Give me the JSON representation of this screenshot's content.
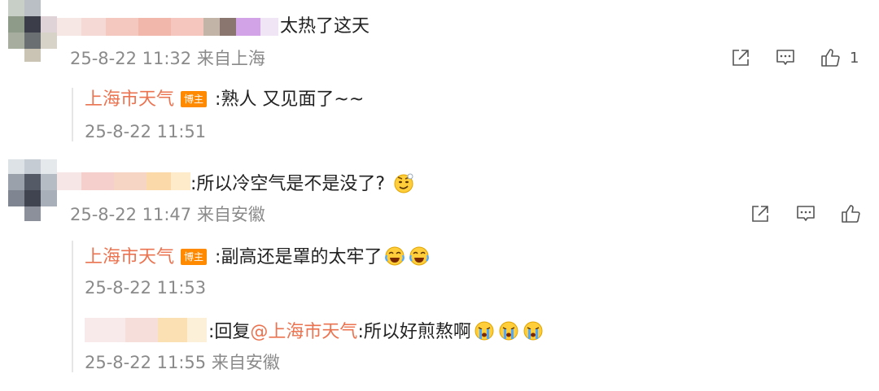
{
  "comments": [
    {
      "text": "太热了这天",
      "meta": "25-8-22 11:32 来自上海",
      "like_count": "1",
      "replies": [
        {
          "name": "上海市天气",
          "badge": "博主",
          "text": ":熟人 又见面了~~",
          "meta": "25-8-22 11:51"
        }
      ]
    },
    {
      "text": ":所以冷空气是不是没了?",
      "meta": "25-8-22 11:47 来自安徽",
      "replies": [
        {
          "name": "上海市天气",
          "badge": "博主",
          "text": ":副高还是罩的太牢了",
          "meta": "25-8-22 11:53"
        },
        {
          "reply_prefix": ":回复",
          "mention": "@上海市天气",
          "text": ":所以好煎熬啊",
          "meta": "25-8-22 11:55 来自安徽"
        }
      ]
    }
  ],
  "icons": {
    "share": "share-icon",
    "comment": "comment-icon",
    "like": "thumbs-up-icon",
    "emoji_smirk": "smirk-emoji-icon",
    "emoji_laugh_cry": "laugh-cry-emoji-icon",
    "emoji_cry": "cry-emoji-icon"
  },
  "colors": {
    "blogger_name": "#eb7350",
    "badge_bg": "#ff8a00",
    "meta_text": "#8a8a8a"
  }
}
